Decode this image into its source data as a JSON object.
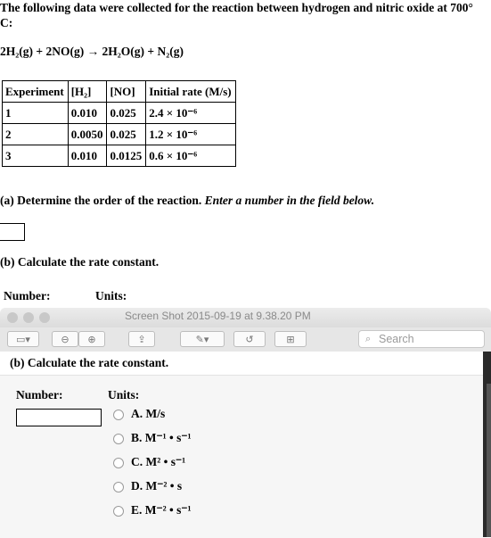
{
  "intro": {
    "line1": "The following data were collected for the reaction between hydrogen and nitric oxide at 700°",
    "line2": "C:"
  },
  "equation": "2H₂(g) + 2NO(g) → 2H₂O(g) + N₂(g)",
  "table": {
    "headers": [
      "Experiment",
      "[H₂]",
      "[NO]",
      "Initial rate (M/s)"
    ],
    "rows": [
      [
        "1",
        "0.010",
        "0.025",
        "2.4 × 10⁻⁶"
      ],
      [
        "2",
        "0.0050",
        "0.025",
        "1.2 × 10⁻⁶"
      ],
      [
        "3",
        "0.010",
        "0.0125",
        "0.6 × 10⁻⁶"
      ]
    ]
  },
  "part_a": {
    "text": "(a) Determine the order of the reaction.",
    "hint": "Enter a number in the field below.",
    "value": ""
  },
  "part_b": {
    "text": "(b) Calculate the rate constant.",
    "number_label": "Number:",
    "units_label": "Units:"
  },
  "window": {
    "title": "Screen Shot 2015-09-19 at 9.38.20 PM",
    "search_placeholder": "Search"
  },
  "panel": {
    "part_b_text": "(b) Calculate the rate constant.",
    "number_label": "Number:",
    "units_label": "Units:",
    "number_value": "",
    "options": [
      "A. M/s",
      "B. M⁻¹ • s⁻¹",
      "C. M² • s⁻¹",
      "D. M⁻² • s",
      "E. M⁻² • s⁻¹"
    ]
  }
}
